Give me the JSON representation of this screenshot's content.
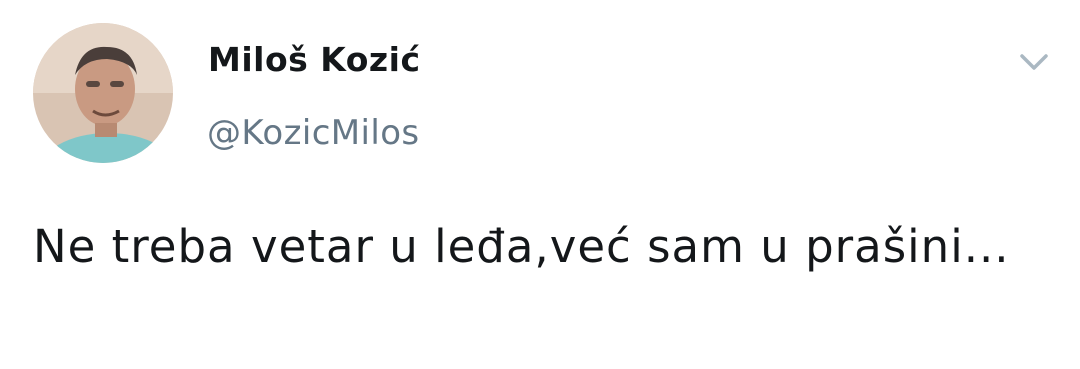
{
  "author": {
    "display_name": "Miloš Kozić",
    "handle": "@KozicMilos"
  },
  "tweet": {
    "text": "Ne treba vetar u leđa,već sam u prašini..."
  },
  "icons": {
    "menu": "chevron-down-icon",
    "avatar": "profile-photo"
  },
  "colors": {
    "name": "#14171a",
    "handle": "#657786",
    "caret": "#aab8c2",
    "background": "#ffffff"
  }
}
